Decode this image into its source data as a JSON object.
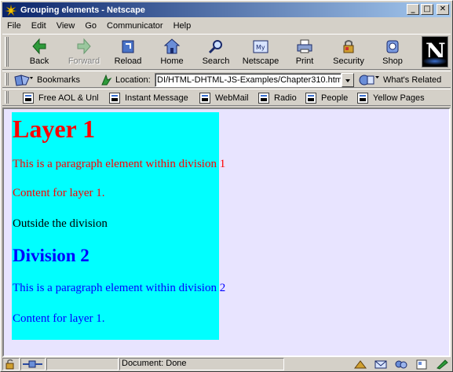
{
  "window": {
    "title": "Grouping elements - Netscape",
    "minimize": "_",
    "maximize": "□",
    "close": "✕"
  },
  "menu": [
    {
      "label": "File"
    },
    {
      "label": "Edit"
    },
    {
      "label": "View"
    },
    {
      "label": "Go"
    },
    {
      "label": "Communicator"
    },
    {
      "label": "Help"
    }
  ],
  "toolbar": {
    "back": "Back",
    "forward": "Forward",
    "reload": "Reload",
    "home": "Home",
    "search": "Search",
    "netscape": "Netscape",
    "print": "Print",
    "security": "Security",
    "shop": "Shop",
    "logo_letter": "N"
  },
  "location": {
    "bookmarks": "Bookmarks",
    "label": "Location:",
    "url": "DI/HTML-DHTML-JS-Examples/Chapter310.html",
    "related": "What's Related"
  },
  "personal": [
    {
      "label": "Free AOL & Unl"
    },
    {
      "label": "Instant Message"
    },
    {
      "label": "WebMail"
    },
    {
      "label": "Radio"
    },
    {
      "label": "People"
    },
    {
      "label": "Yellow Pages"
    }
  ],
  "page": {
    "layer_heading": "Layer 1",
    "layer_para": "This is a paragraph element within division 1",
    "layer_content": "Content for layer 1.",
    "outside": "Outside the division",
    "div2_heading": "Division 2",
    "div2_para": "This is a paragraph element within division 2",
    "div2_content": "Content for layer 1.",
    "colors": {
      "layer_bg": "#00ffff",
      "page_bg": "#e8e4ff",
      "layer_text": "#ff0000",
      "div2_text": "#0000ff"
    }
  },
  "status": {
    "text": "Document: Done"
  }
}
